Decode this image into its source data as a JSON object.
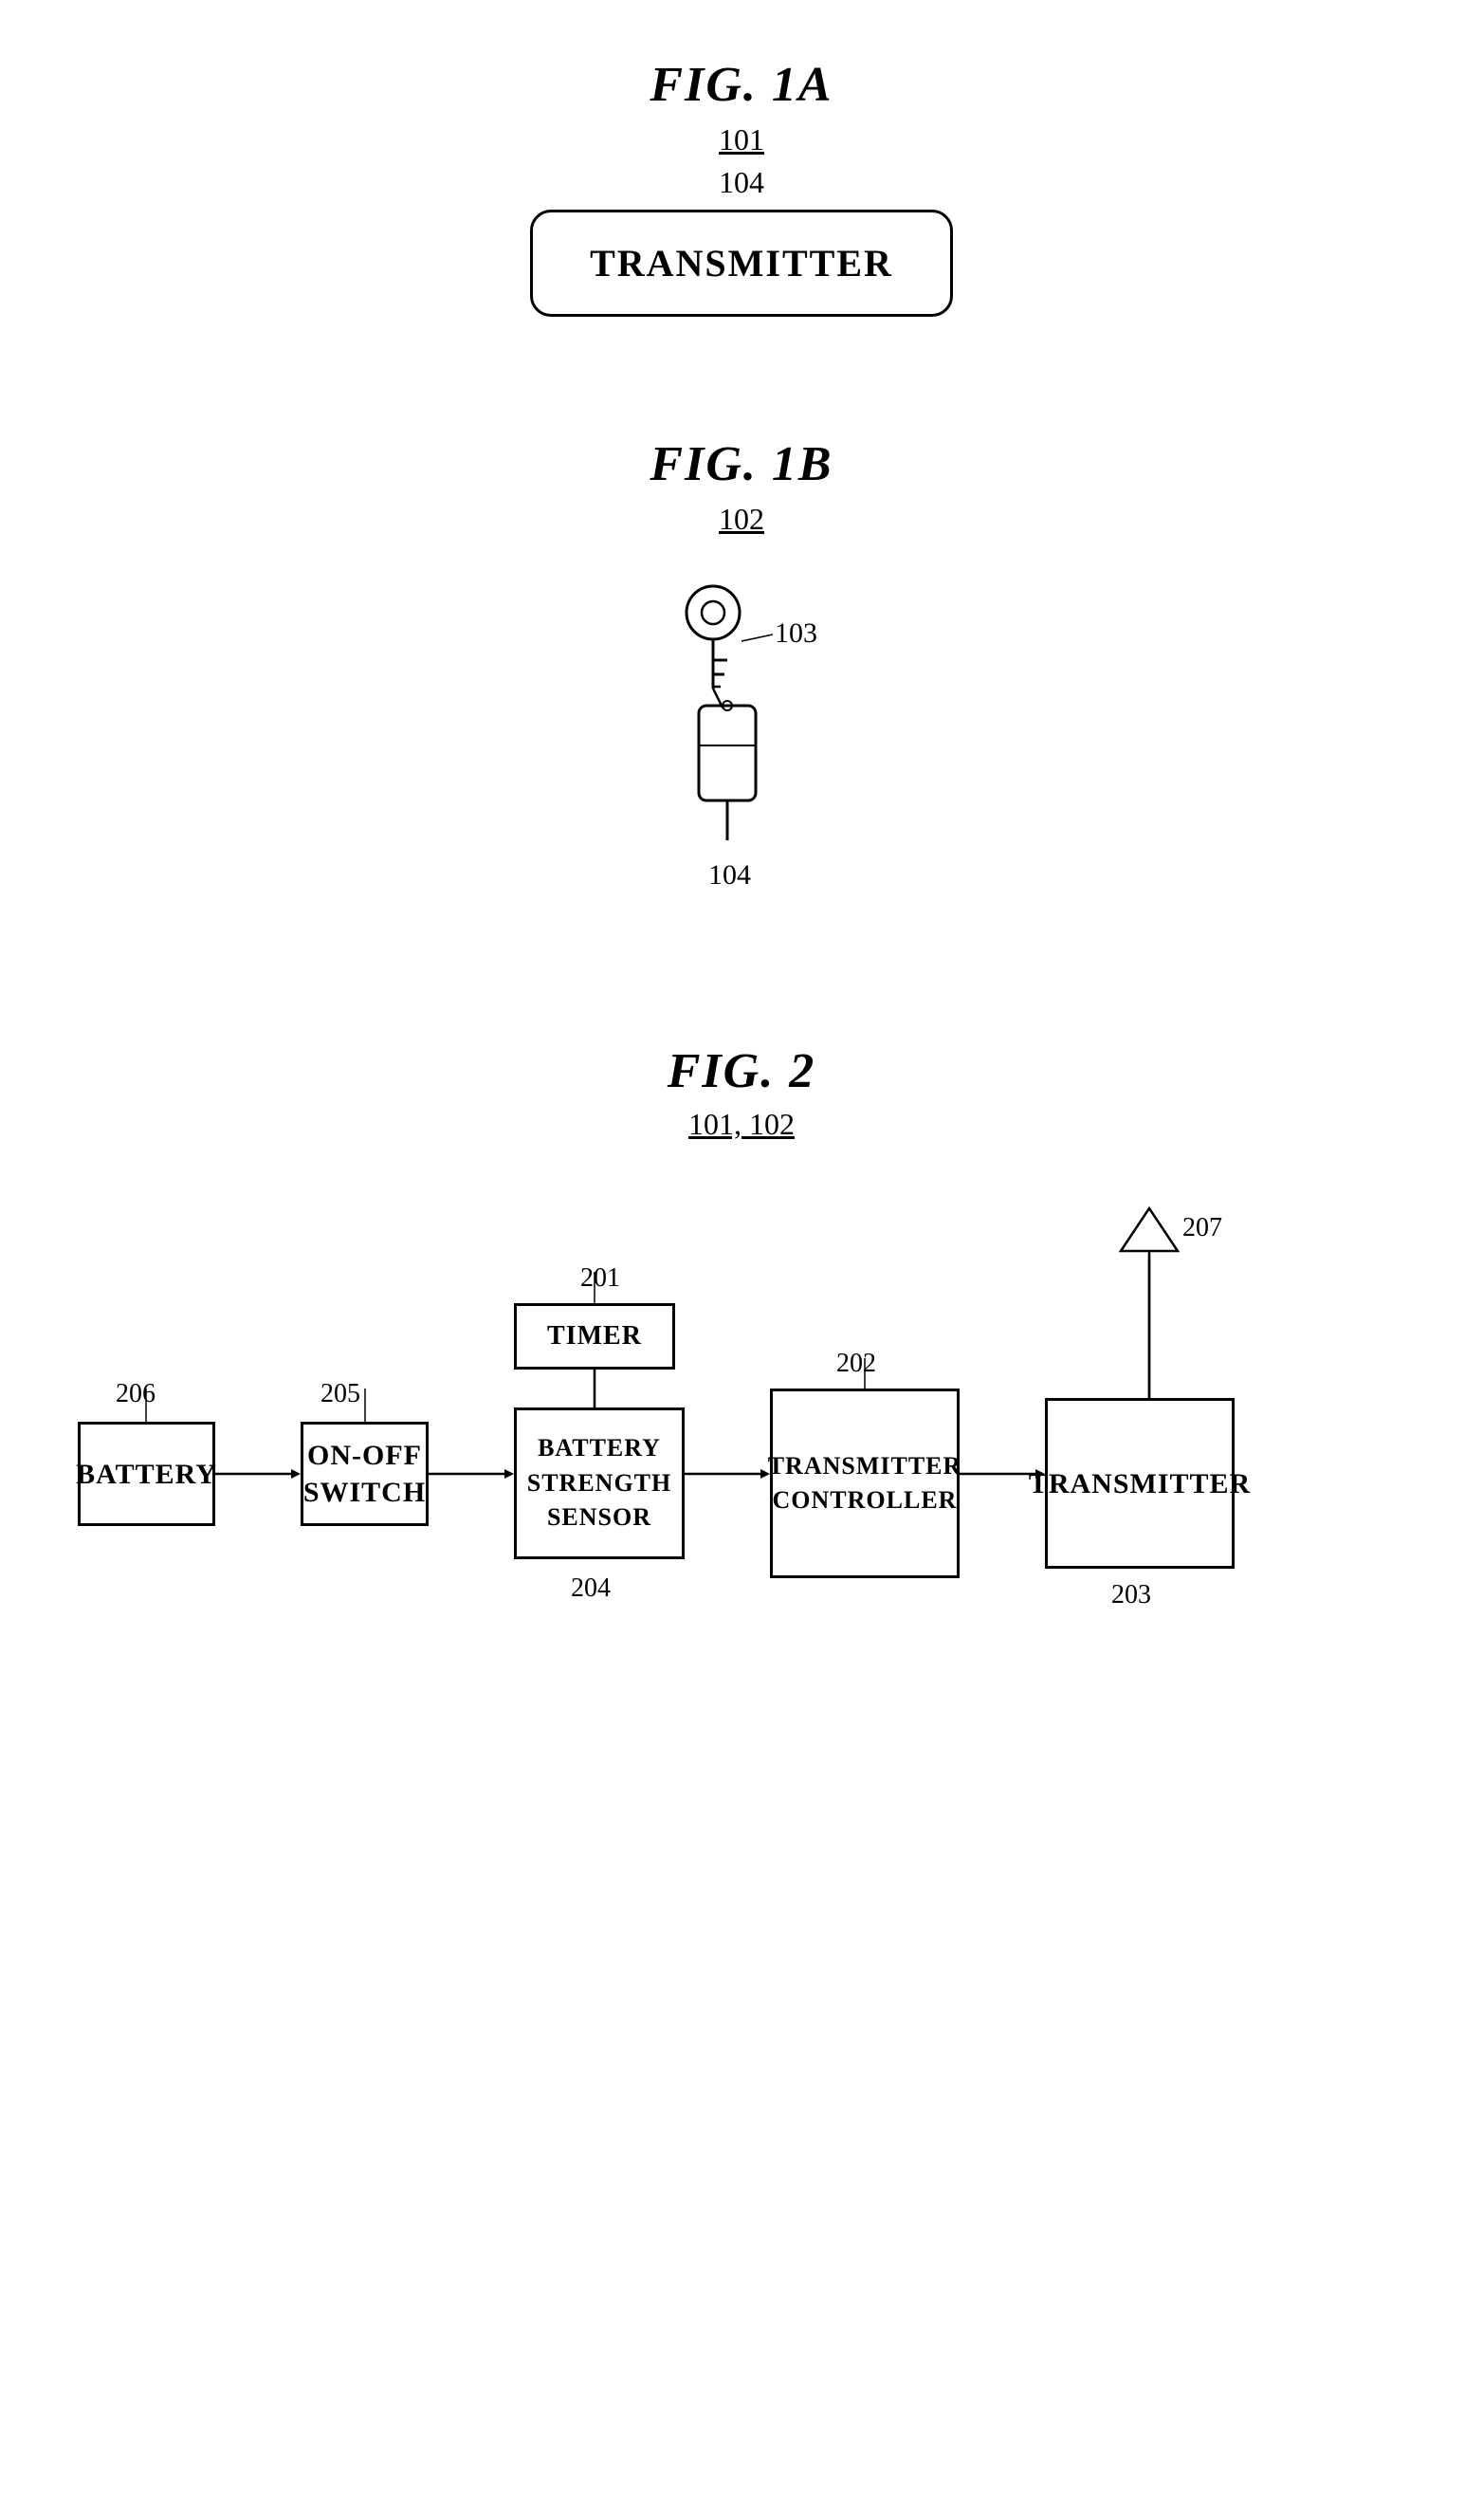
{
  "fig1a": {
    "title": "FIG. 1A",
    "ref": "101",
    "label104": "104",
    "transmitter_text": "TRANSMITTER"
  },
  "fig1b": {
    "title": "FIG. 1B",
    "ref": "102",
    "label103": "103",
    "label104": "104"
  },
  "fig2": {
    "title": "FIG. 2",
    "ref": "101, 102",
    "blocks": {
      "battery": "BATTERY",
      "on_off_switch": "ON-OFF\nSWITCH",
      "timer": "TIMER",
      "battery_strength_sensor": "BATTERY\nSTRENGTH\nSENSOR",
      "transmitter_controller": "TRANSMITTER\nCONTROLLER",
      "transmitter": "TRANSMITTER"
    },
    "labels": {
      "l201": "201",
      "l202": "202",
      "l203": "203",
      "l204": "204",
      "l205": "205",
      "l206": "206",
      "l207": "207"
    }
  }
}
